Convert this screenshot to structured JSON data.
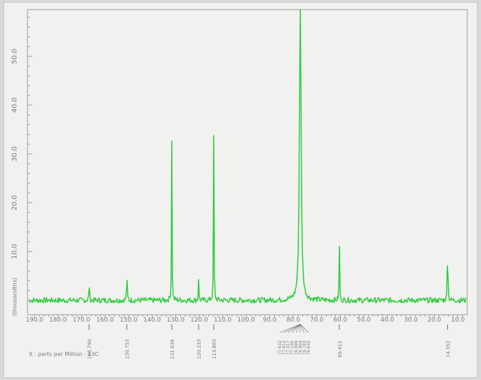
{
  "chart_data": {
    "type": "line",
    "title": "",
    "spectrum_type": "13C NMR",
    "xlabel": "X : parts per Million : 13C",
    "ylabel": "(thousandths)",
    "x_reversed": true,
    "xlim": [
      193.0,
      6.0
    ],
    "ylim": [
      -2.0,
      60.0
    ],
    "x_ticks": [
      "190.0",
      "180.0",
      "170.0",
      "160.0",
      "150.0",
      "140.0",
      "130.0",
      "120.0",
      "110.0",
      "100.0",
      "90.0",
      "80.0",
      "70.0",
      "60.0",
      "50.0",
      "40.0",
      "30.0",
      "20.0",
      "10.0"
    ],
    "y_ticks": [
      "10.0",
      "20.0",
      "30.0",
      "40.0",
      "50.0"
    ],
    "peaks": [
      {
        "ppm": 166.79,
        "height": 4.4
      },
      {
        "ppm": 150.75,
        "height": 7.4
      },
      {
        "ppm": 131.64,
        "height": 33.0
      },
      {
        "ppm": 120.23,
        "height": 4.6
      },
      {
        "ppm": 113.8,
        "height": 34.4
      },
      {
        "ppm": 77.0,
        "height": 70.0
      },
      {
        "ppm": 60.41,
        "height": 14.2
      },
      {
        "ppm": 14.35,
        "height": 16.5
      }
    ],
    "peak_labels": [
      {
        "ppm": 166.79,
        "text": "166.790"
      },
      {
        "ppm": 150.75,
        "text": "150.753"
      },
      {
        "ppm": 131.64,
        "text": "131.636"
      },
      {
        "ppm": 120.23,
        "text": "120.233"
      },
      {
        "ppm": 113.8,
        "text": "113.803"
      },
      {
        "ppm": 60.41,
        "text": "60.412"
      },
      {
        "ppm": 14.35,
        "text": "14.352"
      }
    ],
    "solvent_labels": [
      "77.632",
      "77.412",
      "77.317",
      "77.190",
      "76.999",
      "76.904",
      "76.783",
      "76.650"
    ],
    "baseline": 0.0,
    "grid": false,
    "colors": {
      "trace": "#33cc44",
      "axis": "#9b9b9b",
      "text": "#7a7a7a",
      "background": "#f1f1ef"
    }
  }
}
